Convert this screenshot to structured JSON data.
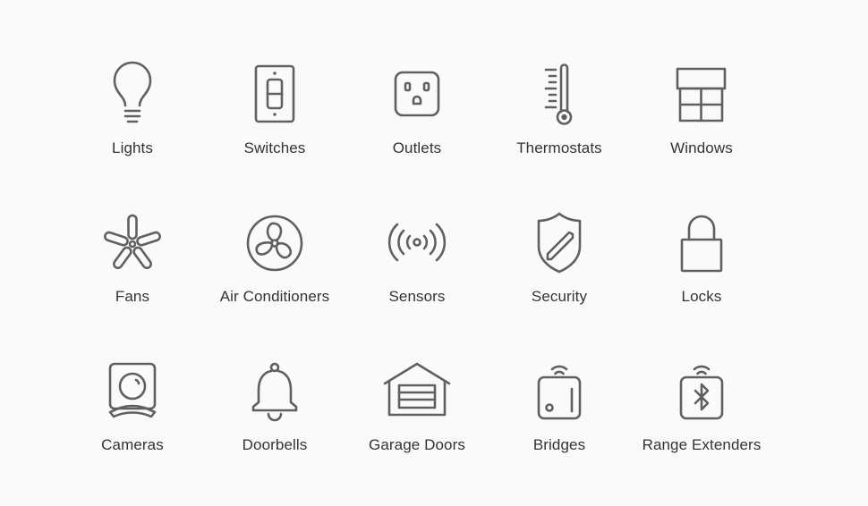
{
  "colors": {
    "background": "#fafafa",
    "icon": "#606060",
    "label": "#333333"
  },
  "categories": [
    {
      "label": "Lights",
      "icon": "lightbulb-icon"
    },
    {
      "label": "Switches",
      "icon": "switch-icon"
    },
    {
      "label": "Outlets",
      "icon": "outlet-icon"
    },
    {
      "label": "Thermostats",
      "icon": "thermometer-icon"
    },
    {
      "label": "Windows",
      "icon": "window-icon"
    },
    {
      "label": "Fans",
      "icon": "fan-icon"
    },
    {
      "label": "Air Conditioners",
      "icon": "air-conditioner-icon"
    },
    {
      "label": "Sensors",
      "icon": "sensor-icon"
    },
    {
      "label": "Security",
      "icon": "shield-icon"
    },
    {
      "label": "Locks",
      "icon": "lock-icon"
    },
    {
      "label": "Cameras",
      "icon": "camera-icon"
    },
    {
      "label": "Doorbells",
      "icon": "bell-icon"
    },
    {
      "label": "Garage Doors",
      "icon": "garage-door-icon"
    },
    {
      "label": "Bridges",
      "icon": "bridge-icon"
    },
    {
      "label": "Range Extenders",
      "icon": "range-extender-icon"
    }
  ]
}
